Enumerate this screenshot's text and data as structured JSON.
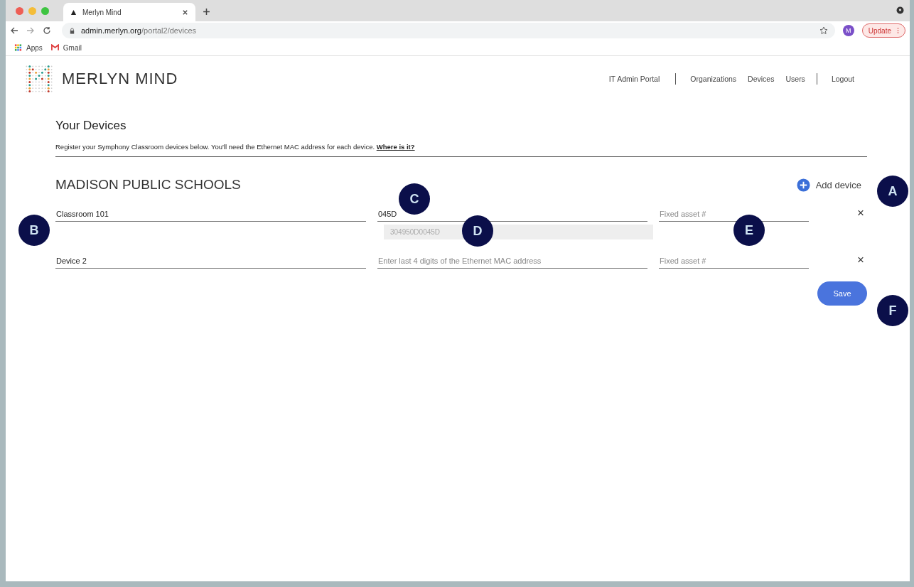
{
  "browser": {
    "tab_title": "Merlyn Mind",
    "url_host": "admin.merlyn.org",
    "url_path": "/portal2/devices",
    "profile_initial": "M",
    "update_label": "Update",
    "bookmarks": [
      "Apps",
      "Gmail"
    ]
  },
  "header": {
    "brand": "MERLYN MIND",
    "nav": [
      {
        "label": "IT Admin Portal",
        "kind": "text"
      },
      {
        "kind": "divider"
      },
      {
        "label": "Organizations",
        "kind": "link"
      },
      {
        "label": "Devices",
        "kind": "link"
      },
      {
        "label": "Users",
        "kind": "link"
      },
      {
        "kind": "divider"
      },
      {
        "label": "Logout",
        "kind": "link"
      }
    ]
  },
  "page": {
    "title": "Your Devices",
    "description": "Register your Symphony Classroom devices below. You'll need the Ethernet MAC address for each device.",
    "help_link": "Where is it?",
    "organization": "MADISON PUBLIC SCHOOLS",
    "add_button": "Add device",
    "save_button": "Save"
  },
  "devices": [
    {
      "name": "Classroom 101",
      "mac": "045D",
      "mac_full": "304950D0045D",
      "asset_placeholder": "Fixed asset #",
      "remove": "×"
    },
    {
      "name": "Device 2",
      "mac_placeholder": "Enter last 4 digits of the Ethernet MAC address",
      "asset_placeholder": "Fixed asset #",
      "remove": "×"
    }
  ],
  "callouts": [
    {
      "label": "A"
    },
    {
      "label": "B"
    },
    {
      "label": "C"
    },
    {
      "label": "D"
    },
    {
      "label": "E"
    },
    {
      "label": "F"
    }
  ]
}
